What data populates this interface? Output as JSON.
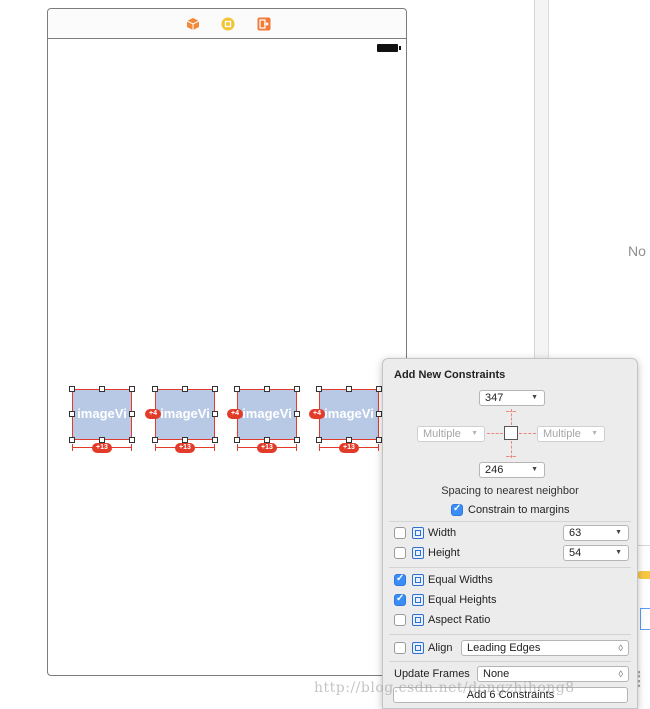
{
  "colors": {
    "accent": "#3a8df5",
    "constraint_red": "#e23b2a",
    "image_view_fill": "#b8c9e6",
    "scene_icon_orange": "#f08a3a",
    "scene_icon_yellow": "#f5c230",
    "scene_icon_exit": "#f07b3a"
  },
  "inspector": {
    "no_selection_text": "No"
  },
  "scene": {
    "bar_icons": [
      "cube-icon",
      "first-responder-icon",
      "exit-icon"
    ],
    "image_views": [
      {
        "label": "imageVi",
        "bottom_badge": "+13",
        "left_badge": ""
      },
      {
        "label": "imageVi",
        "bottom_badge": "+13",
        "left_badge": "+4"
      },
      {
        "label": "imageVi",
        "bottom_badge": "+13",
        "left_badge": "+4"
      },
      {
        "label": "imageVi",
        "bottom_badge": "+13",
        "left_badge": "+4"
      }
    ]
  },
  "popover": {
    "title": "Add New Constraints",
    "top_value": "347",
    "bottom_value": "246",
    "left_value": "Multiple",
    "right_value": "Multiple",
    "spacing_hint": "Spacing to nearest neighbor",
    "constrain_margins": {
      "label": "Constrain to margins",
      "checked": true
    },
    "width": {
      "label": "Width",
      "value": "63",
      "checked": false
    },
    "height": {
      "label": "Height",
      "value": "54",
      "checked": false
    },
    "equal_widths": {
      "label": "Equal Widths",
      "checked": true
    },
    "equal_heights": {
      "label": "Equal Heights",
      "checked": true
    },
    "aspect_ratio": {
      "label": "Aspect Ratio",
      "checked": false
    },
    "align": {
      "label": "Align",
      "value": "Leading Edges",
      "checked": false
    },
    "update_frames": {
      "label": "Update Frames",
      "value": "None"
    },
    "add_button": "Add 6 Constraints"
  },
  "watermark": "http://blog.csdn.net/dengzhihong8"
}
